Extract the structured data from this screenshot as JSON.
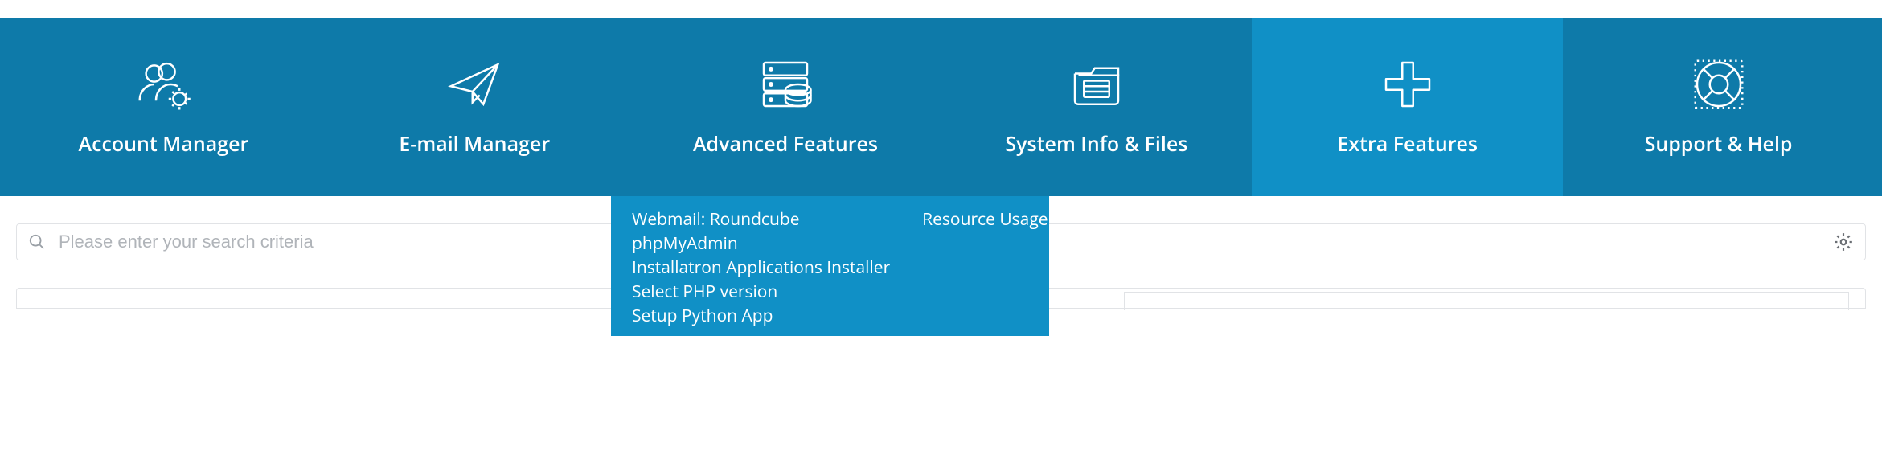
{
  "nav": {
    "items": [
      {
        "label": "Account Manager"
      },
      {
        "label": "E-mail Manager"
      },
      {
        "label": "Advanced Features"
      },
      {
        "label": "System Info & Files"
      },
      {
        "label": "Extra Features"
      },
      {
        "label": "Support & Help"
      }
    ]
  },
  "dropdown": {
    "col1": [
      "Webmail: Roundcube",
      "phpMyAdmin",
      "Installatron Applications Installer",
      "Select PHP version",
      "Setup Python App"
    ],
    "col2": [
      "Resource Usage"
    ]
  },
  "search": {
    "placeholder": "Please enter your search criteria",
    "value": ""
  },
  "colors": {
    "nav_bg": "#0e7aa9",
    "nav_active_bg": "#1090c6"
  }
}
